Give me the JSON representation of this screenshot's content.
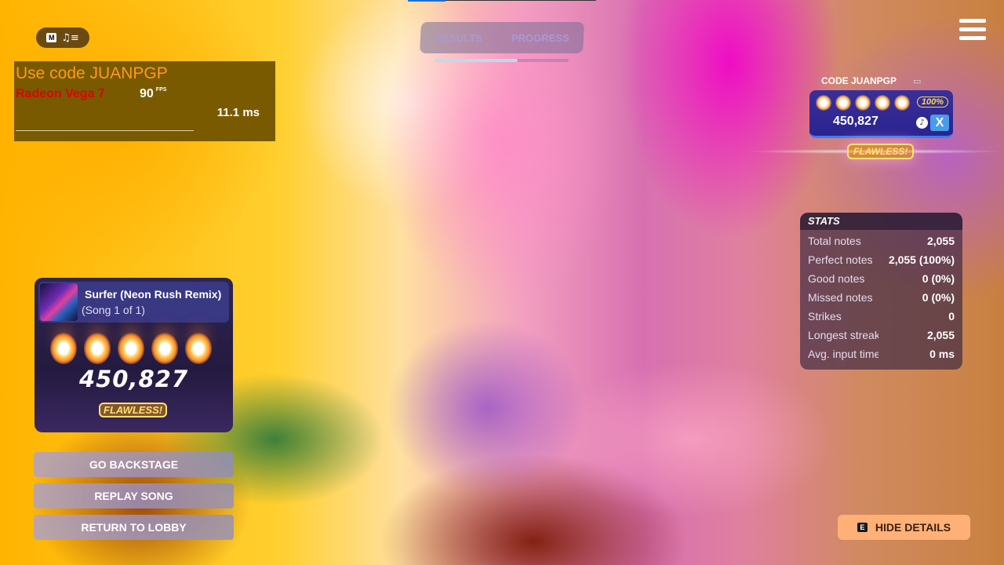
{
  "overlay": {
    "music_key": "M",
    "music_icon": "music-queue-icon",
    "promo_code": "Use code JUANPGP",
    "gpu": "Radeon Vega 7",
    "fps": "90",
    "fps_unit": "FPS",
    "frame_time": "11.1 ms"
  },
  "tabs": [
    {
      "label": "RESULTS"
    },
    {
      "label": "PROGRESS"
    }
  ],
  "tab_progress": 0.62,
  "player": {
    "name": "CODE JUANPGP",
    "percent": "100%",
    "score": "450,827",
    "instrument_badge": "X",
    "rating": "FLAWLESS!",
    "stars": 5
  },
  "stats": {
    "title": "STATS",
    "rows": [
      {
        "label": "Total notes",
        "value": "2,055"
      },
      {
        "label": "Perfect notes",
        "value": "2,055 (100%)"
      },
      {
        "label": "Good notes",
        "value": "0 (0%)"
      },
      {
        "label": "Missed notes",
        "value": "0 (0%)"
      },
      {
        "label": "Strikes",
        "value": "0"
      },
      {
        "label": "Longest streak",
        "value": "2,055"
      },
      {
        "label": "Avg. input time",
        "value": "0 ms"
      }
    ]
  },
  "song": {
    "title": "Surfer (Neon Rush Remix)",
    "subtitle": "(Song 1 of 1)",
    "score": "450,827",
    "rating": "FLAWLESS!",
    "stars": 5
  },
  "buttons": {
    "backstage": "GO BACKSTAGE",
    "replay": "REPLAY SONG",
    "lobby": "RETURN TO LOBBY"
  },
  "hide_details": {
    "key": "E",
    "label": "HIDE DETAILS"
  },
  "colors": {
    "accent_gold": "#ffe070",
    "hide_button": "#ffb077",
    "player_card": "#2a2390"
  }
}
